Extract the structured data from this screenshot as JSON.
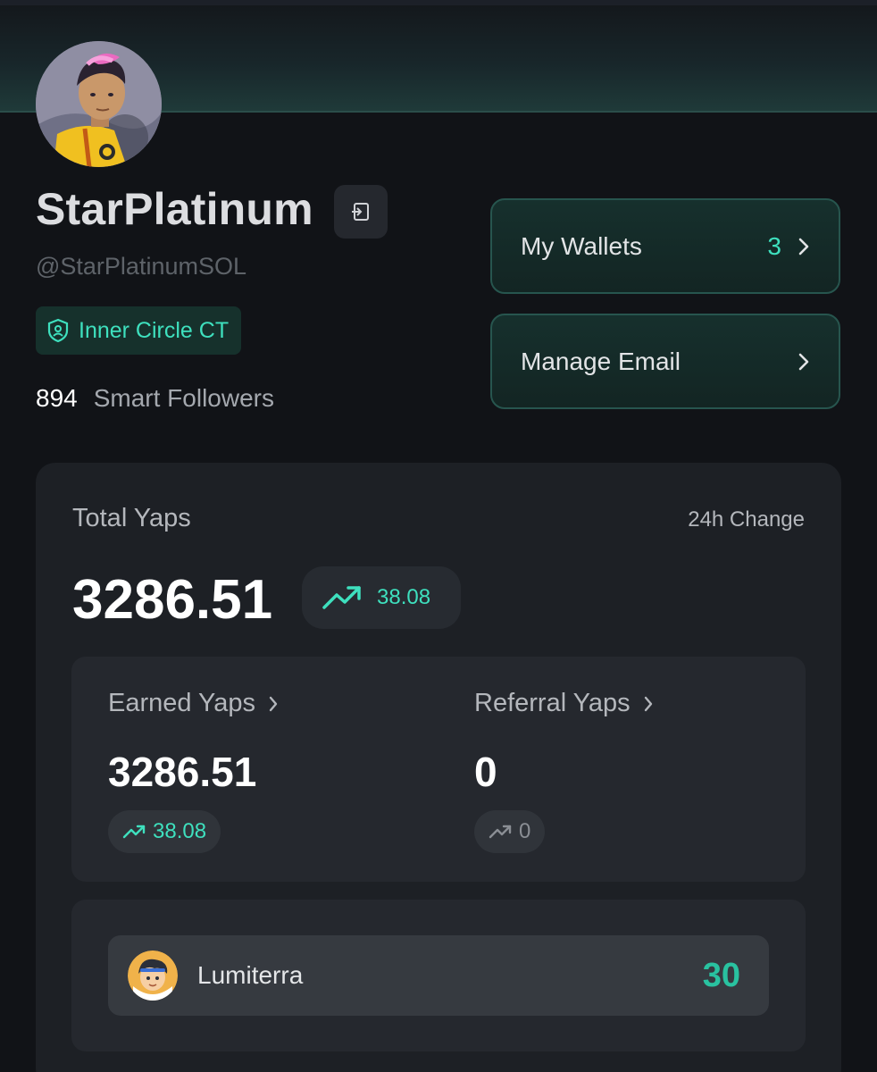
{
  "profile": {
    "name": "StarPlatinum",
    "handle": "@StarPlatinumSOL",
    "badge": "Inner Circle CT",
    "followers_count": "894",
    "followers_label": "Smart Followers"
  },
  "actions": {
    "wallets_label": "My Wallets",
    "wallets_count": "3",
    "email_label": "Manage Email"
  },
  "yaps": {
    "total_label": "Total Yaps",
    "change_label": "24h Change",
    "total_value": "3286.51",
    "total_change": "38.08",
    "earned_label": "Earned Yaps",
    "earned_value": "3286.51",
    "earned_change": "38.08",
    "referral_label": "Referral Yaps",
    "referral_value": "0",
    "referral_change": "0"
  },
  "projects": [
    {
      "name": "Lumiterra",
      "score": "30"
    }
  ],
  "colors": {
    "accent": "#3ee0be",
    "background": "#111317",
    "card": "#1d2025"
  }
}
